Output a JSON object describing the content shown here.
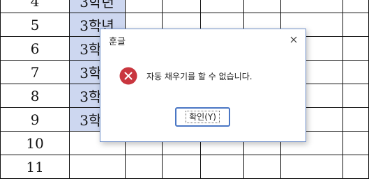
{
  "sheet": {
    "rows": [
      {
        "num": "4",
        "grade": "3학년"
      },
      {
        "num": "5",
        "grade": "3학년"
      },
      {
        "num": "6",
        "grade": "3학년"
      },
      {
        "num": "7",
        "grade": "3학년"
      },
      {
        "num": "8",
        "grade": "3학년"
      },
      {
        "num": "9",
        "grade": "3학년"
      },
      {
        "num": "10",
        "grade": ""
      },
      {
        "num": "11",
        "grade": ""
      }
    ],
    "selection_color": "#cdd7f0"
  },
  "dialog": {
    "title": "훈글",
    "message": "자동 채우기를 할 수 없습니다.",
    "ok_label": "확인(Y)",
    "icon": "error-icon",
    "accent_color": "#4a76c4",
    "error_color": "#c9363f"
  }
}
